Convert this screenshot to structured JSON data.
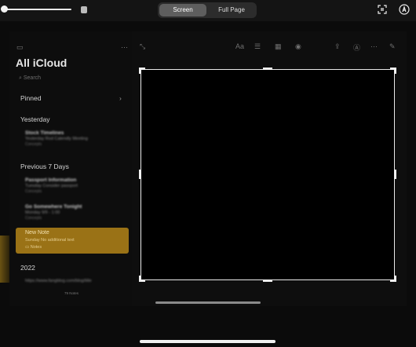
{
  "toolbar": {
    "screen_label": "Screen",
    "full_page_label": "Full Page",
    "selected_tab": "Screen"
  },
  "app": {
    "title": "All iCloud",
    "search_placeholder": "Search",
    "sections": {
      "pinned": "Pinned",
      "yesterday": "Yesterday",
      "previous7": "Previous 7 Days",
      "year": "2022"
    },
    "notes": [
      {
        "title": "Stock Timelines",
        "snippet": "Yesterday  Rod Calendly Meeting",
        "folder": "Concepts"
      },
      {
        "title": "Passport Information",
        "snippet": "Tuesday  Consider passport",
        "folder": "Concepts"
      },
      {
        "title": "Go Somewhere Tonight",
        "snippet": "Monday  9/9 - 1:00",
        "folder": "Concepts"
      }
    ],
    "selected_note": {
      "title": "New Note",
      "snippet": "Sunday  No additional text",
      "folder": "Notes"
    },
    "year_note_snippet": "https://www.fangblog.com/blog/title",
    "note_count": "79 Notes"
  },
  "icons": {
    "crop": "crop-icon",
    "markup": "markup-pen-icon",
    "sidebar": "sidebar-toggle-icon"
  }
}
